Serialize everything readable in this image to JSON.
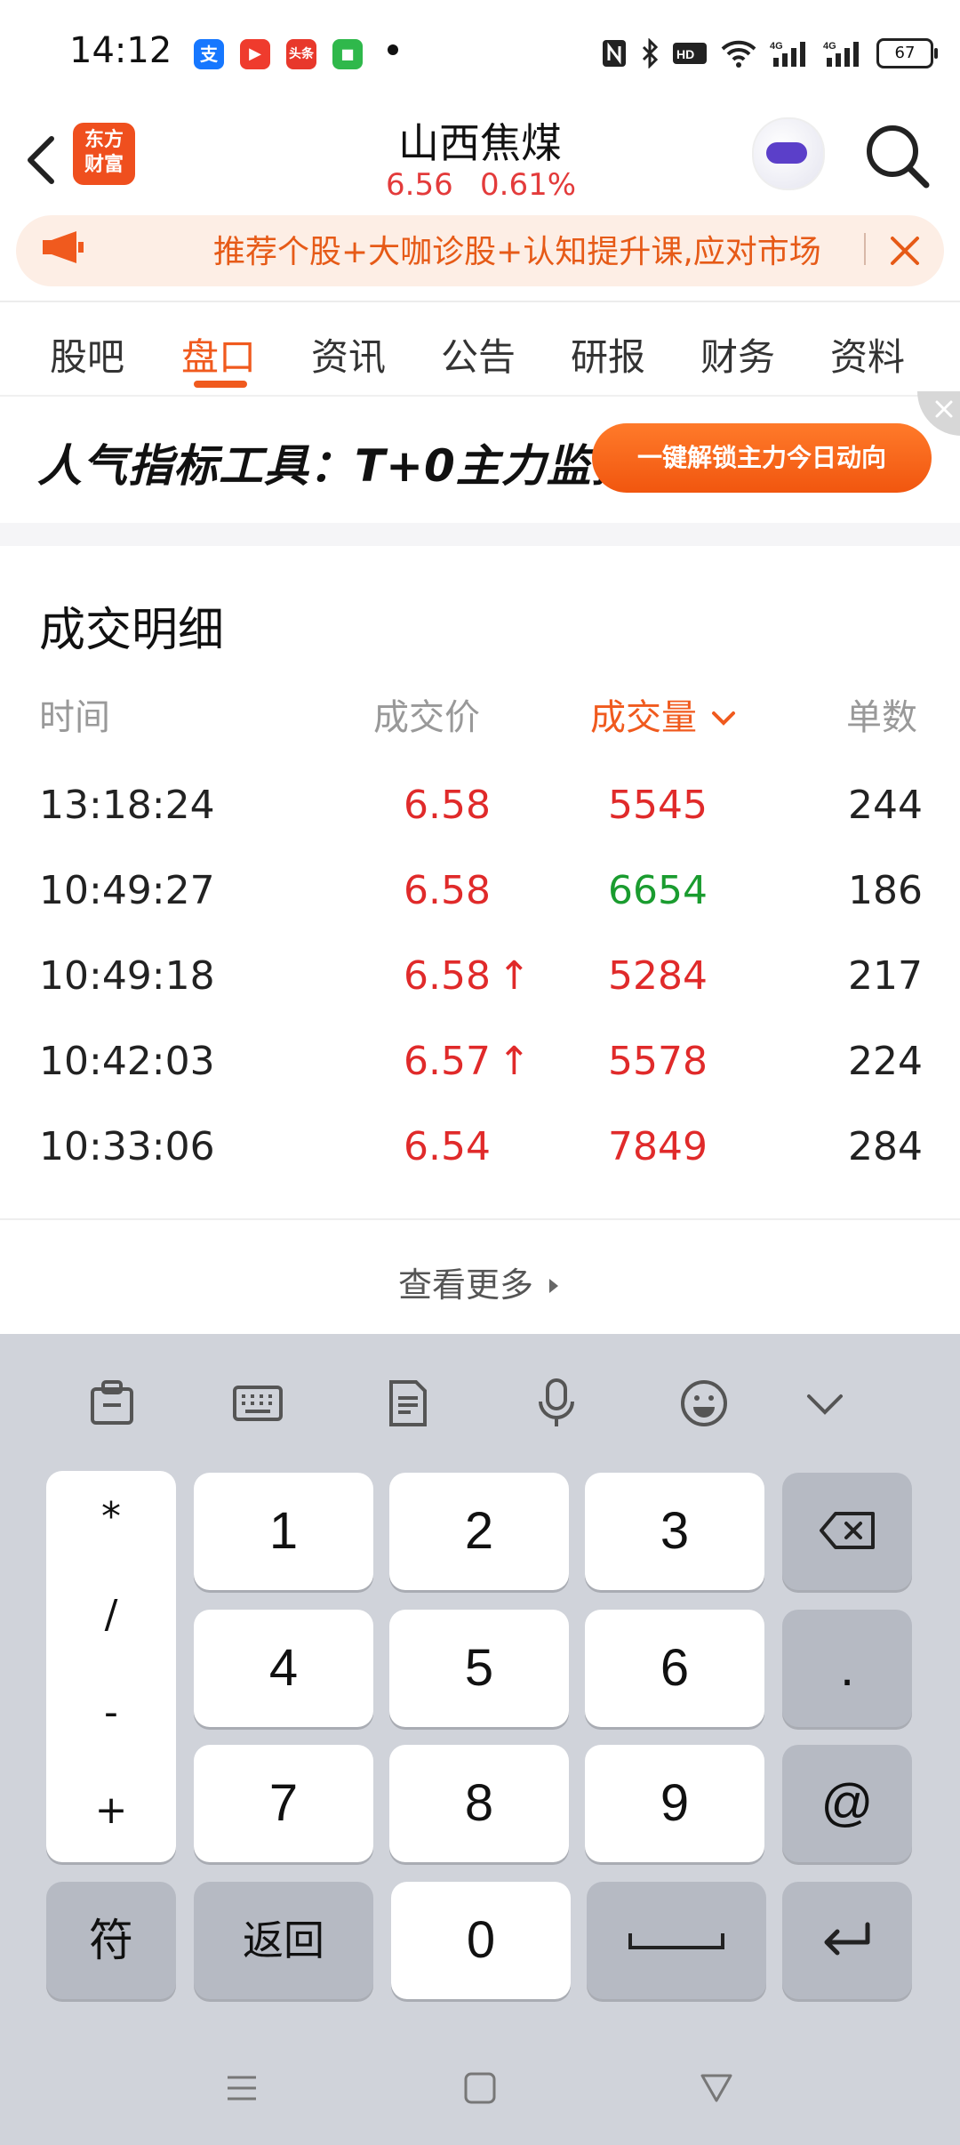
{
  "status_bar": {
    "time": "14:12",
    "battery": "67",
    "app_icons": [
      "alipay-icon",
      "video-icon",
      "toutiao-icon",
      "chat-icon"
    ],
    "app_icon_labels": [
      "支",
      "▶",
      "头条",
      "■"
    ]
  },
  "header": {
    "stock_name": "山西焦煤",
    "price": "6.56",
    "change_pct": "0.61%",
    "logo_text": "东方财富"
  },
  "banner": {
    "text": "推荐个股+大咖诊股+认知提升课,应对市场"
  },
  "tabs": [
    "股吧",
    "盘口",
    "资讯",
    "公告",
    "研报",
    "财务",
    "资料"
  ],
  "active_tab": "盘口",
  "ad": {
    "text": "人气指标工具：T+0主力监控",
    "button": "一键解锁主力今日动向"
  },
  "trade_detail": {
    "title": "成交明细",
    "headers": {
      "time": "时间",
      "price": "成交价",
      "volume": "成交量",
      "count": "单数"
    },
    "rows": [
      {
        "time": "13:18:24",
        "price": "6.58",
        "up": false,
        "volume": "5545",
        "volume_color": "#e02a2a",
        "count": "244"
      },
      {
        "time": "10:49:27",
        "price": "6.58",
        "up": false,
        "volume": "6654",
        "volume_color": "#1a9c2f",
        "count": "186"
      },
      {
        "time": "10:49:18",
        "price": "6.58",
        "up": true,
        "volume": "5284",
        "volume_color": "#e02a2a",
        "count": "217"
      },
      {
        "time": "10:42:03",
        "price": "6.57",
        "up": true,
        "volume": "5578",
        "volume_color": "#e02a2a",
        "count": "224"
      },
      {
        "time": "10:33:06",
        "price": "6.54",
        "up": false,
        "volume": "7849",
        "volume_color": "#e02a2a",
        "count": "284"
      }
    ],
    "view_more": "查看更多"
  },
  "keyboard": {
    "symbols": [
      "*",
      "/",
      "-",
      "+"
    ],
    "digits": [
      "1",
      "2",
      "3",
      "4",
      "5",
      "6",
      "7",
      "8",
      "9",
      "0"
    ],
    "dot": ".",
    "at": "@",
    "sym_key": "符",
    "back_key": "返回"
  },
  "colors": {
    "accent": "#f05a1e",
    "up": "#e02a2a",
    "down": "#1a9c2f"
  }
}
